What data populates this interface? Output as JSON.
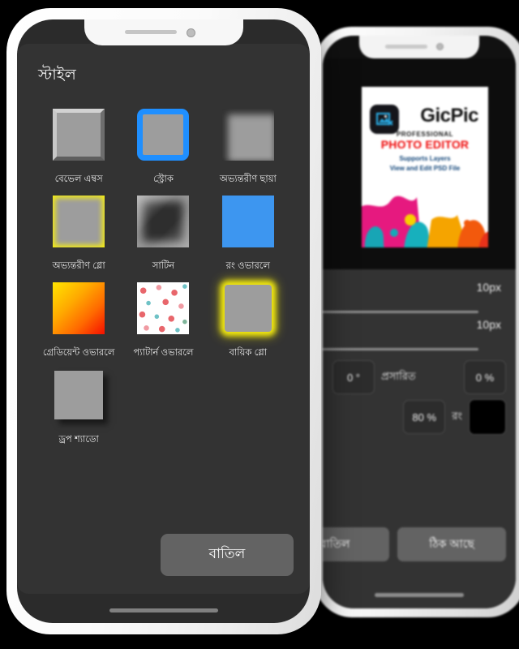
{
  "front_phone": {
    "sheet_title": "স্টাইল",
    "styles": [
      {
        "label": "বেভেল এম্বস",
        "icon": "bevel-emboss-thumb"
      },
      {
        "label": "স্ট্রোক",
        "icon": "stroke-thumb"
      },
      {
        "label": "অভ্যন্তরীণ ছায়া",
        "icon": "inner-shadow-thumb"
      },
      {
        "label": "অভ্যন্তরীণ গ্লো",
        "icon": "inner-glow-thumb"
      },
      {
        "label": "সাটিন",
        "icon": "satin-thumb"
      },
      {
        "label": "রং ওভারলে",
        "icon": "color-overlay-thumb"
      },
      {
        "label": "গ্রেডিয়েন্ট ওভারলে",
        "icon": "gradient-overlay-thumb"
      },
      {
        "label": "প্যাটার্ন ওভারলে",
        "icon": "pattern-overlay-thumb"
      },
      {
        "label": "বায়িক গ্লো",
        "icon": "outer-glow-thumb"
      },
      {
        "label": "ড্রপ শ্যাডো",
        "icon": "drop-shadow-thumb"
      }
    ],
    "cancel_label": "বাতিল"
  },
  "back_phone": {
    "promo": {
      "title": "GicPic",
      "professional": "PROFESSIONAL",
      "photo_editor": "PHOTO EDITOR",
      "sub1": "Supports Layers",
      "sub2": "View and Edit PSD File",
      "logo_icon": "image-crop-icon"
    },
    "sliders": [
      {
        "value": "10px"
      },
      {
        "value": "10px"
      }
    ],
    "fields": {
      "angle": "0 °",
      "spread_label": "প্রসারিত",
      "spread_value": "0 %",
      "opacity_value": "80 %",
      "color_label": "রং",
      "color_swatch": "#000000"
    },
    "buttons": {
      "cancel_label": "বাতিল",
      "ok_label": "ঠিক আছে"
    }
  },
  "colors": {
    "sheet_bg": "#333333",
    "screen_bg": "#2b2b2b",
    "stroke_blue": "#1f8fff",
    "glow_yellow": "#f2e90f",
    "color_overlay_blue": "#3d96f0",
    "button_gray": "#636363",
    "promo_red": "#ef0c0c",
    "promo_blue": "#12467a"
  }
}
